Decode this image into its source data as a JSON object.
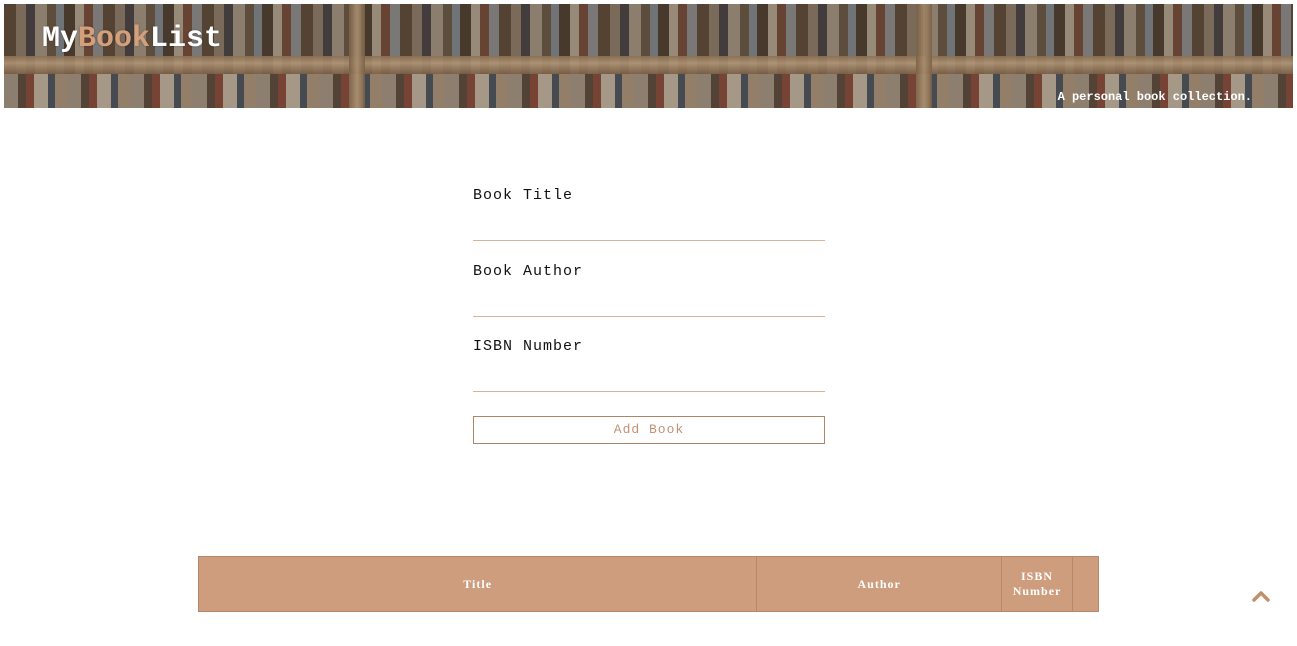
{
  "header": {
    "logo_part1": "My",
    "logo_part2": "Book",
    "logo_part3": "List",
    "tagline": "A personal book collection."
  },
  "form": {
    "title_label": "Book Title",
    "title_value": "",
    "author_label": "Book Author",
    "author_value": "",
    "isbn_label": "ISBN Number",
    "isbn_value": "",
    "add_button_label": "Add Book"
  },
  "table": {
    "columns": [
      "Title",
      "Author",
      "ISBN Number",
      ""
    ]
  },
  "scroll_top_icon": "chevron-up-icon",
  "colors": {
    "accent": "#cd9d7e",
    "accent_text": "#c0927a",
    "border": "#b08466"
  }
}
